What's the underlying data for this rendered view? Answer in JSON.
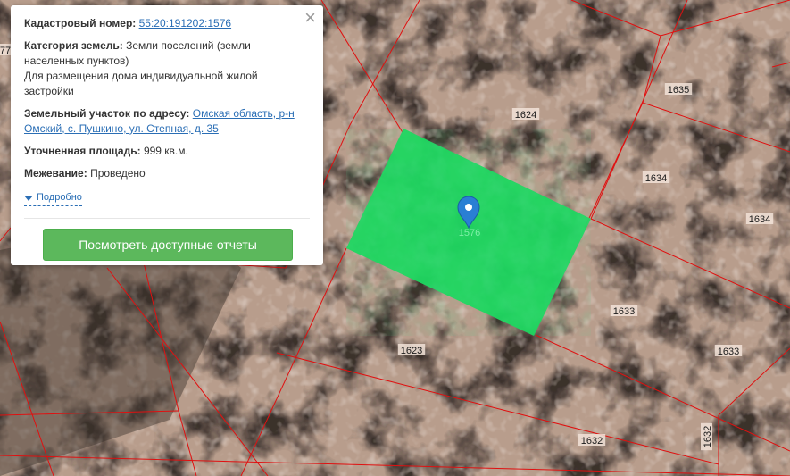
{
  "popup": {
    "cadastral_label": "Кадастровый номер:",
    "cadastral_value": "55:20:191202:1576",
    "category_label": "Категория земель:",
    "category_value": "Земли поселений (земли населенных пунктов)",
    "usage": "Для размещения дома индивидуальной жилой застройки",
    "address_label": "Земельный участок по адресу:",
    "address_value": "Омская область, р-н Омский, с. Пушкино, ул. Степная, д. 35",
    "area_label": "Уточненная площадь:",
    "area_value": "999 кв.м.",
    "survey_label": "Межевание:",
    "survey_value": "Проведено",
    "more_label": "Подробно",
    "report_button": "Посмотреть доступные отчеты",
    "close_glyph": "×"
  },
  "map": {
    "selected_plot_label": "1576",
    "plot_labels": [
      "1624",
      "1635",
      "1634",
      "1634",
      "1633",
      "1633",
      "1623",
      "1632",
      "1632",
      "77"
    ],
    "colors": {
      "selected_fill": "#1ed760",
      "boundary": "#e01010",
      "marker": "#2a7fd4"
    },
    "icons": {
      "marker": "map-pin-icon",
      "close": "close-icon",
      "more": "triangle-down-icon"
    }
  }
}
